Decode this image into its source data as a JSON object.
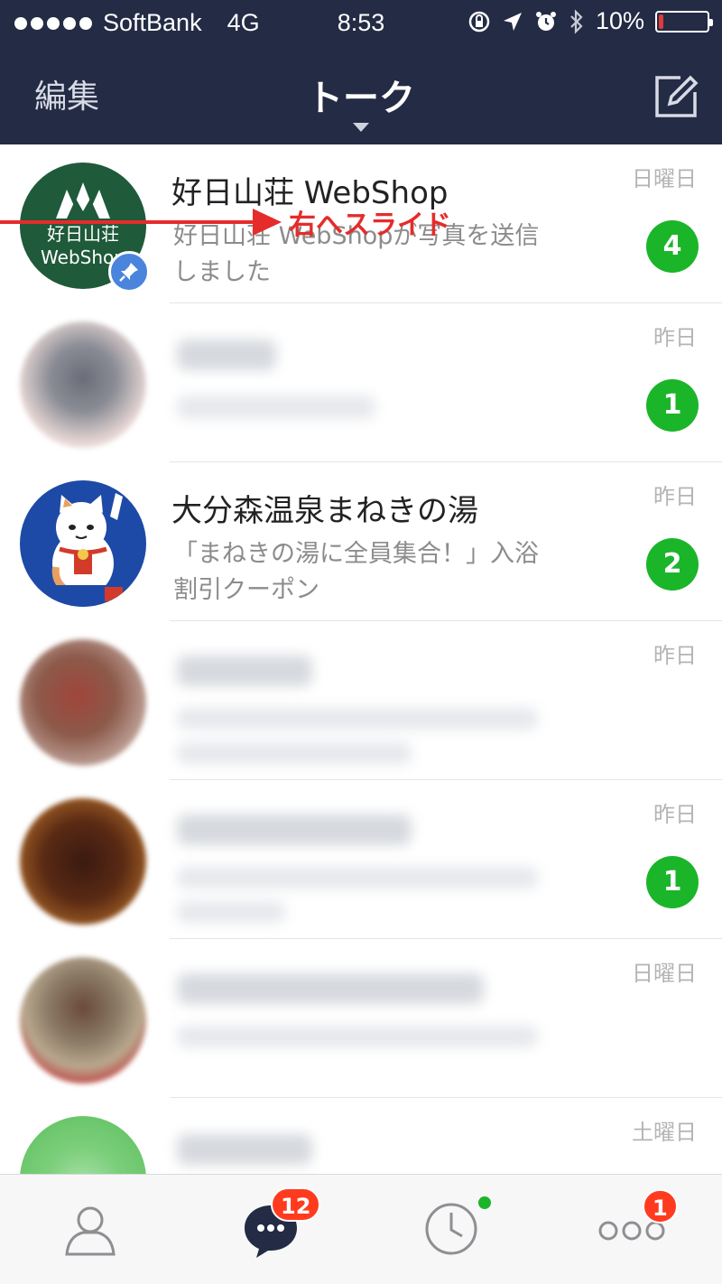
{
  "status_bar": {
    "carrier": "SoftBank",
    "network": "4G",
    "time": "8:53",
    "battery_text": "10%",
    "battery_level": 0.1
  },
  "nav": {
    "edit_label": "編集",
    "title": "トーク"
  },
  "annotation": {
    "label": "右へスライド",
    "color": "#e62b2b"
  },
  "chats": [
    {
      "name": "好日山荘 WebShop",
      "preview": "好日山荘 WebShopが写真を送信しました",
      "date": "日曜日",
      "unread": "4",
      "pinned": true,
      "avatar_lines": [
        "好日山荘",
        "WebShop"
      ]
    },
    {
      "date": "昨日",
      "unread": "1",
      "blurred": true
    },
    {
      "name": "大分森温泉まねきの湯",
      "preview": "「まねきの湯に全員集合！」入浴割引クーポン",
      "date": "昨日",
      "unread": "2"
    },
    {
      "date": "昨日",
      "blurred": true
    },
    {
      "date": "昨日",
      "unread": "1",
      "blurred": true
    },
    {
      "date": "日曜日",
      "blurred": true
    },
    {
      "date": "土曜日",
      "blurred": true
    }
  ],
  "tabs": {
    "chats_badge": "12",
    "more_badge": "1"
  },
  "colors": {
    "header_bg": "#232b45",
    "unread_badge": "#1bb52a",
    "tab_badge": "#ff3b1f",
    "pin_badge": "#4a84dd"
  }
}
